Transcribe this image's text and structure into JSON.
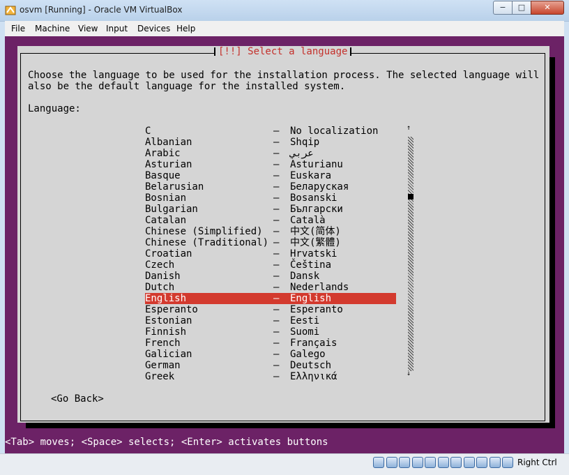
{
  "window": {
    "title": "osvm [Running] - Oracle VM VirtualBox",
    "minimize_glyph": "−",
    "maximize_glyph": "□",
    "close_glyph": "✕"
  },
  "menu": [
    "File",
    "Machine",
    "View",
    "Input",
    "Devices",
    "Help"
  ],
  "dialog": {
    "title": "[!!] Select a language",
    "instructions": "Choose the language to be used for the installation process. The selected language will\nalso be the default language for the installed system.",
    "language_label": "Language:",
    "languages": [
      {
        "name": "C",
        "native": "No localization"
      },
      {
        "name": "Albanian",
        "native": "Shqip"
      },
      {
        "name": "Arabic",
        "native": "عربي"
      },
      {
        "name": "Asturian",
        "native": "Asturianu"
      },
      {
        "name": "Basque",
        "native": "Euskara"
      },
      {
        "name": "Belarusian",
        "native": "Беларуская"
      },
      {
        "name": "Bosnian",
        "native": "Bosanski"
      },
      {
        "name": "Bulgarian",
        "native": "Български"
      },
      {
        "name": "Catalan",
        "native": "Català"
      },
      {
        "name": "Chinese (Simplified)",
        "native": "中文(简体)"
      },
      {
        "name": "Chinese (Traditional)",
        "native": "中文(繁體)"
      },
      {
        "name": "Croatian",
        "native": "Hrvatski"
      },
      {
        "name": "Czech",
        "native": "Čeština"
      },
      {
        "name": "Danish",
        "native": "Dansk"
      },
      {
        "name": "Dutch",
        "native": "Nederlands"
      },
      {
        "name": "English",
        "native": "English",
        "selected": true
      },
      {
        "name": "Esperanto",
        "native": "Esperanto"
      },
      {
        "name": "Estonian",
        "native": "Eesti"
      },
      {
        "name": "Finnish",
        "native": "Suomi"
      },
      {
        "name": "French",
        "native": "Français"
      },
      {
        "name": "Galician",
        "native": "Galego"
      },
      {
        "name": "German",
        "native": "Deutsch"
      },
      {
        "name": "Greek",
        "native": "Ελληνικά"
      }
    ],
    "separator": "–",
    "scroll_up": "↑",
    "scroll_down": "↓",
    "go_back": "<Go Back>"
  },
  "help_line": "<Tab> moves; <Space> selects; <Enter> activates buttons",
  "statusbar": {
    "icons": [
      "hard-disk-icon",
      "optical-drive-icon",
      "audio-icon",
      "network-icon",
      "usb-icon",
      "shared-folder-icon",
      "display-icon",
      "video-capture-icon",
      "virtualization-icon",
      "mouse-integration-icon",
      "keyboard-icon"
    ],
    "host_key": "Right Ctrl"
  },
  "colors": {
    "vm_background": "#6c2266",
    "dialog_background": "#d5d5d5",
    "selection": "#d33a2e",
    "title_text": "#c4302b"
  }
}
